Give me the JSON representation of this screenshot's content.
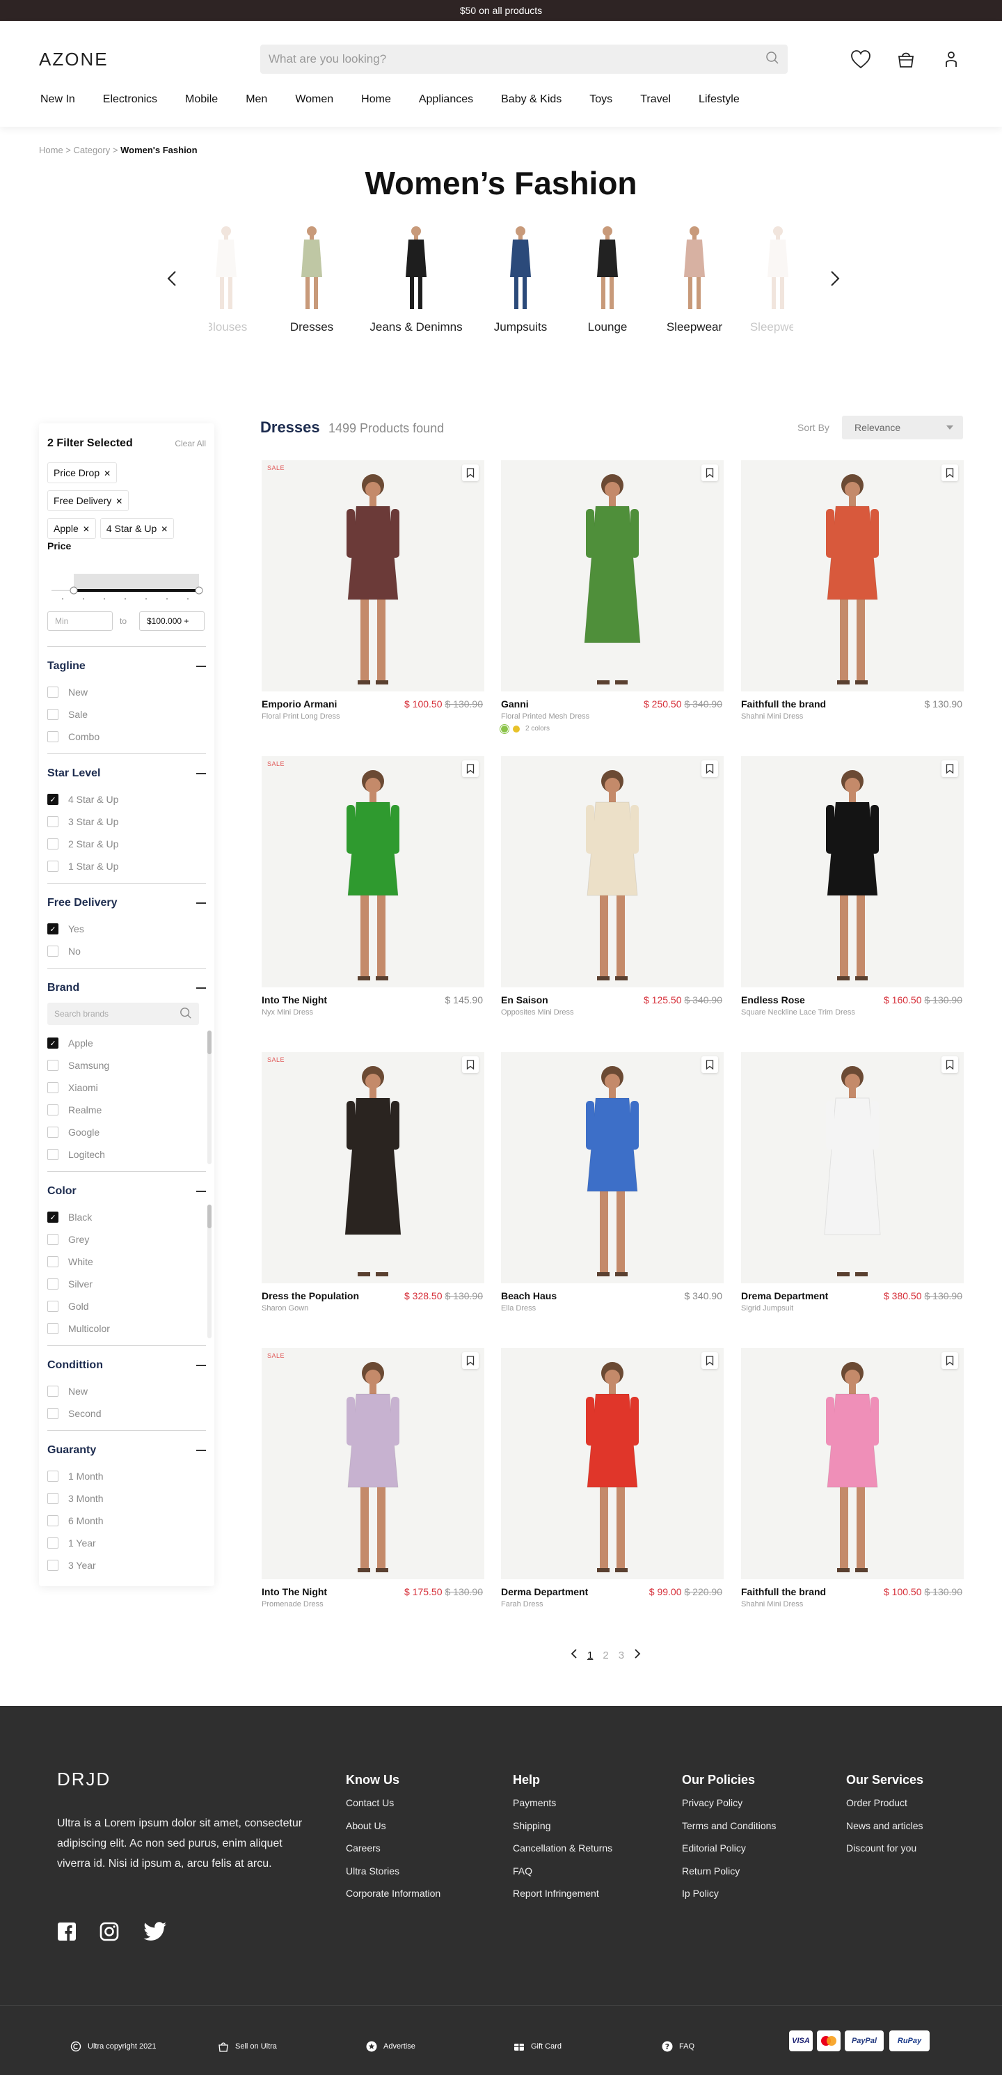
{
  "topbar": {
    "text": "$50 on all products"
  },
  "header": {
    "logo": "AZONE",
    "search_placeholder": "What are you looking?",
    "nav": [
      "New In",
      "Electronics",
      "Mobile",
      "Men",
      "Women",
      "Home",
      "Appliances",
      "Baby & Kids",
      "Toys",
      "Travel",
      "Lifestyle"
    ]
  },
  "breadcrumb": {
    "home": "Home",
    "sep1": " > ",
    "category": "Category",
    "sep2": " > ",
    "current": "Women's Fashion"
  },
  "page_title": "Women’s Fashion",
  "categories": [
    "Blouses",
    "Dresses",
    "Jeans & Denimns",
    "Jumpsuits",
    "Lounge",
    "Sleepwear",
    "Sleepwear"
  ],
  "filters": {
    "title": "2 Filter Selected",
    "clear": "Clear All",
    "chips": [
      "Price Drop",
      "Free Delivery",
      "Apple",
      "4 Star & Up"
    ],
    "price": {
      "title": "Price",
      "min_placeholder": "Min",
      "to": "to",
      "max": "$100.000 +"
    },
    "sections": [
      {
        "title": "Tagline",
        "options": [
          {
            "label": "New",
            "checked": false
          },
          {
            "label": "Sale",
            "checked": false
          },
          {
            "label": "Combo",
            "checked": false
          }
        ]
      },
      {
        "title": "Star Level",
        "options": [
          {
            "label": "4 Star & Up",
            "checked": true
          },
          {
            "label": "3 Star & Up",
            "checked": false
          },
          {
            "label": "2 Star & Up",
            "checked": false
          },
          {
            "label": "1 Star & Up",
            "checked": false
          }
        ]
      },
      {
        "title": "Free Delivery",
        "options": [
          {
            "label": "Yes",
            "checked": true
          },
          {
            "label": "No",
            "checked": false
          }
        ]
      },
      {
        "title": "Brand",
        "search_placeholder": "Search brands",
        "options": [
          {
            "label": "Apple",
            "checked": true
          },
          {
            "label": "Samsung",
            "checked": false
          },
          {
            "label": "Xiaomi",
            "checked": false
          },
          {
            "label": "Realme",
            "checked": false
          },
          {
            "label": "Google",
            "checked": false
          },
          {
            "label": "Logitech",
            "checked": false
          }
        ]
      },
      {
        "title": "Color",
        "options": [
          {
            "label": "Black",
            "checked": true
          },
          {
            "label": "Grey",
            "checked": false
          },
          {
            "label": "White",
            "checked": false
          },
          {
            "label": "Silver",
            "checked": false
          },
          {
            "label": "Gold",
            "checked": false
          },
          {
            "label": "Multicolor",
            "checked": false
          }
        ]
      },
      {
        "title": "Condittion",
        "options": [
          {
            "label": "New",
            "checked": false
          },
          {
            "label": "Second",
            "checked": false
          }
        ]
      },
      {
        "title": "Guaranty",
        "options": [
          {
            "label": "1 Month",
            "checked": false
          },
          {
            "label": "3 Month",
            "checked": false
          },
          {
            "label": "6 Month",
            "checked": false
          },
          {
            "label": "1 Year",
            "checked": false
          },
          {
            "label": "3 Year",
            "checked": false
          }
        ]
      }
    ]
  },
  "results": {
    "title": "Dresses",
    "count": "1499 Products found",
    "sort_label": "Sort By",
    "sort_value": "Relevance"
  },
  "products": [
    {
      "name": "Emporio Armani",
      "sub": "Floral Print Long Dress",
      "price": "$ 100.50",
      "was": "$ 130.90",
      "sale": true,
      "dress": "#6b3a38"
    },
    {
      "name": "Ganni",
      "sub": "Floral Printed Mesh Dress",
      "price": "$ 250.50",
      "was": "$ 340.90",
      "sale": false,
      "dress": "#4f8f3a",
      "colors": "2 colors"
    },
    {
      "name": "Faithfull the brand",
      "sub": "Shahni Mini Dress",
      "price": "$ 130.90",
      "was": "",
      "sale": false,
      "dress": "#d8593c"
    },
    {
      "name": "Into The Night",
      "sub": "Nyx Mini Dress",
      "price": "$ 145.90",
      "was": "",
      "sale": true,
      "dress": "#2f9a2f"
    },
    {
      "name": "En Saison",
      "sub": "Opposites Mini Dress",
      "price": "$ 125.50",
      "was": "$ 340.90",
      "sale": false,
      "dress": "#ece0c8"
    },
    {
      "name": "Endless Rose",
      "sub": "Square Neckline Lace Trim Dress",
      "price": "$ 160.50",
      "was": "$ 130.90",
      "sale": false,
      "dress": "#141414"
    },
    {
      "name": "Dress the Population",
      "sub": "Sharon Gown",
      "price": "$ 328.50",
      "was": "$ 130.90",
      "sale": true,
      "dress": "#2a2420"
    },
    {
      "name": "Beach Haus",
      "sub": "Ella Dress",
      "price": "$ 340.90",
      "was": "",
      "sale": false,
      "dress": "#3d6fc8"
    },
    {
      "name": "Drema Department",
      "sub": "Sigrid Jumpsuit",
      "price": "$ 380.50",
      "was": "$ 130.90",
      "sale": false,
      "dress": "#f4f4f4"
    },
    {
      "name": "Into The Night",
      "sub": "Promenade Dress",
      "price": "$ 175.50",
      "was": "$ 130.90",
      "sale": true,
      "dress": "#c7b2d0"
    },
    {
      "name": "Derma Department",
      "sub": "Farah Dress",
      "price": "$ 99.00",
      "was": "$ 220.90",
      "sale": false,
      "dress": "#e0362a"
    },
    {
      "name": "Faithfull the brand",
      "sub": "Shahni Mini Dress",
      "price": "$ 100.50",
      "was": "$ 130.90",
      "sale": false,
      "dress": "#ef8fb8"
    }
  ],
  "sale_label": "SALE",
  "pagination": {
    "pages": [
      "1",
      "2",
      "3"
    ],
    "current": "1"
  },
  "footer": {
    "logo": "DRJD",
    "about": "Ultra is a Lorem ipsum dolor sit amet, consectetur adipiscing elit.  Ac non sed purus, enim aliquet viverra id. Nisi id ipsum a, arcu felis at arcu.",
    "columns": [
      {
        "title": "Know Us",
        "links": [
          "Contact Us",
          "About Us",
          "Careers",
          "Ultra Stories",
          "Corporate Information"
        ]
      },
      {
        "title": "Help",
        "links": [
          "Payments",
          "Shipping",
          "Cancellation & Returns",
          "FAQ",
          "Report Infringement"
        ]
      },
      {
        "title": "Our Policies",
        "links": [
          "Privacy Policy",
          "Terms and Conditions",
          "Editorial Policy",
          "Return Policy",
          "Ip Policy"
        ]
      },
      {
        "title": "Our Services",
        "links": [
          "Order Product",
          "News and articles",
          "Discount for you"
        ]
      }
    ],
    "bottom": {
      "copyright": "Ultra copyright 2021",
      "sell": "Sell on Ultra",
      "advertise": "Advertise",
      "gift": "Gift Card",
      "faq": "FAQ"
    },
    "payments": [
      "VISA",
      "MC",
      "PayPal",
      "RuPay"
    ]
  },
  "colors": {
    "accent_red": "#d6303a",
    "topbar": "#2e2424",
    "footer": "#2f2f2f"
  }
}
